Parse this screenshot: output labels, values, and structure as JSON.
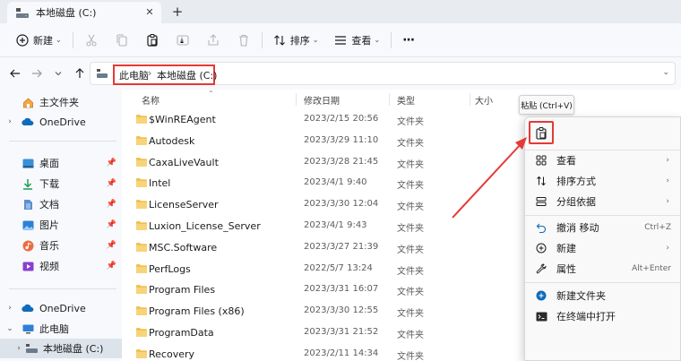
{
  "tab": {
    "title": "本地磁盘 (C:)",
    "close": "✕",
    "new": "+"
  },
  "toolbar": {
    "new_label": "新建",
    "sort_label": "排序",
    "view_label": "查看",
    "more": "···"
  },
  "address": {
    "crumbs": [
      "此电脑",
      "本地磁盘 (C:)"
    ],
    "separator": "›"
  },
  "sidebar": {
    "items": [
      {
        "label": "主文件夹"
      },
      {
        "label": "OneDrive"
      },
      {
        "label": "桌面"
      },
      {
        "label": "下载"
      },
      {
        "label": "文档"
      },
      {
        "label": "图片"
      },
      {
        "label": "音乐"
      },
      {
        "label": "视频"
      },
      {
        "label": "OneDrive"
      },
      {
        "label": "此电脑"
      },
      {
        "label": "本地磁盘 (C:)"
      }
    ]
  },
  "columns": {
    "name": "名称",
    "date": "修改日期",
    "type": "类型",
    "size": "大小"
  },
  "files": [
    {
      "name": "$WinREAgent",
      "date": "2023/2/15 20:56",
      "type": "文件夹"
    },
    {
      "name": "Autodesk",
      "date": "2023/3/29 11:10",
      "type": "文件夹"
    },
    {
      "name": "CaxaLiveVault",
      "date": "2023/3/28 21:45",
      "type": "文件夹"
    },
    {
      "name": "Intel",
      "date": "2023/4/1 9:40",
      "type": "文件夹"
    },
    {
      "name": "LicenseServer",
      "date": "2023/3/30 12:04",
      "type": "文件夹"
    },
    {
      "name": "Luxion_License_Server",
      "date": "2023/4/1 9:43",
      "type": "文件夹"
    },
    {
      "name": "MSC.Software",
      "date": "2023/3/27 21:39",
      "type": "文件夹"
    },
    {
      "name": "PerfLogs",
      "date": "2022/5/7 13:24",
      "type": "文件夹"
    },
    {
      "name": "Program Files",
      "date": "2023/3/31 16:07",
      "type": "文件夹"
    },
    {
      "name": "Program Files (x86)",
      "date": "2023/3/30 12:55",
      "type": "文件夹"
    },
    {
      "name": "ProgramData",
      "date": "2023/3/31 21:52",
      "type": "文件夹"
    },
    {
      "name": "Recovery",
      "date": "2023/2/11 14:34",
      "type": "文件夹"
    }
  ],
  "tooltip": {
    "text": "粘贴 (Ctrl+V)"
  },
  "context_menu": {
    "items": [
      {
        "label": "查看",
        "shortcut": ""
      },
      {
        "label": "排序方式",
        "shortcut": ""
      },
      {
        "label": "分组依据",
        "shortcut": ""
      },
      {
        "label": "撤消 移动",
        "shortcut": "Ctrl+Z"
      },
      {
        "label": "新建",
        "shortcut": ""
      },
      {
        "label": "属性",
        "shortcut": "Alt+Enter"
      },
      {
        "label": "新建文件夹",
        "shortcut": ""
      },
      {
        "label": "在终端中打开",
        "shortcut": ""
      }
    ]
  },
  "colors": {
    "accent": "#0067c0",
    "highlight": "#e53935",
    "folder": "#f2c14e"
  }
}
